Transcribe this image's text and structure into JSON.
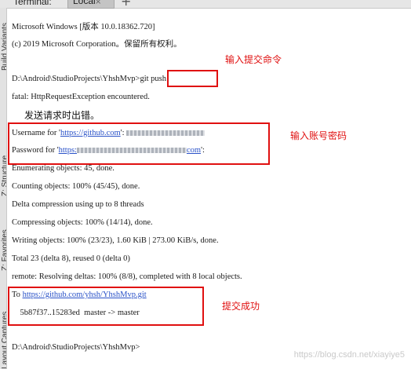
{
  "tabs": {
    "terminal_label": "Terminal:",
    "local_label": "Local",
    "close_glyph": "×",
    "add_glyph": "+"
  },
  "sidebar": {
    "labels": [
      "Build Variants",
      "Z: Structure",
      "Z: Favorites",
      "Layout Captures"
    ]
  },
  "terminal": {
    "header1": "Microsoft Windows [版本 10.0.18362.720]",
    "header2": "(c) 2019 Microsoft Corporation。保留所有权利。",
    "prompt1": "D:\\Android\\StudioProjects\\YhshMvp>",
    "cmd": "git push",
    "fatal": "fatal: HttpRequestException encountered.",
    "username_prefix": "Username for '",
    "username_url": "https://github.com",
    "username_mid": "': ",
    "password_prefix": "Password for '",
    "password_url": "https:",
    "password_url_end": "com",
    "password_suffix": "':",
    "enum": "Enumerating objects: 45, done.",
    "count": "Counting objects: 100% (45/45), done.",
    "delta": "Delta compression using up to 8 threads",
    "compress": "Compressing objects: 100% (14/14), done.",
    "writing": "Writing objects: 100% (23/23), 1.60 KiB | 273.00 KiB/s, done.",
    "total": "Total 23 (delta 8), reused 0 (delta 0)",
    "remote": "remote: Resolving deltas: 100% (8/8), completed with 8 local objects.",
    "to_prefix": "To ",
    "to_url": "https://github.com/yhsh/YhshMvp.git",
    "branch": "    5b87f37..15283ed  master -> master",
    "prompt2": "D:\\Android\\StudioProjects\\YhshMvp>"
  },
  "annotations": {
    "push_cmd": "输入提交命令",
    "error": "发送请求时出错。",
    "credentials": "输入账号密码",
    "success": "提交成功"
  },
  "watermark": "https://blog.csdn.net/xiayiye5",
  "colors": {
    "annotation_red": "#e01010",
    "link_blue": "#2a52c8"
  }
}
